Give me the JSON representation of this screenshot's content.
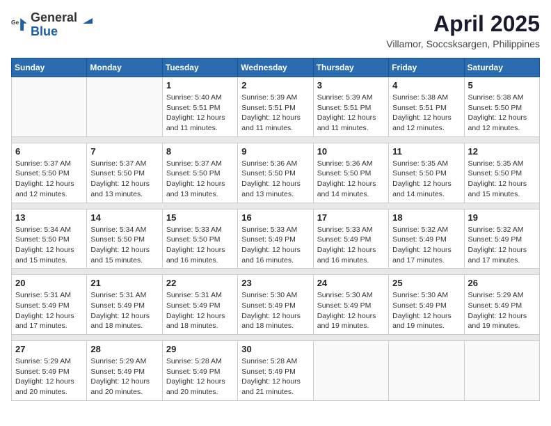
{
  "logo": {
    "general": "General",
    "blue": "Blue"
  },
  "title": "April 2025",
  "subtitle": "Villamor, Soccsksargen, Philippines",
  "weekdays": [
    "Sunday",
    "Monday",
    "Tuesday",
    "Wednesday",
    "Thursday",
    "Friday",
    "Saturday"
  ],
  "weeks": [
    [
      {
        "day": "",
        "sunrise": "",
        "sunset": "",
        "daylight": ""
      },
      {
        "day": "",
        "sunrise": "",
        "sunset": "",
        "daylight": ""
      },
      {
        "day": "1",
        "sunrise": "Sunrise: 5:40 AM",
        "sunset": "Sunset: 5:51 PM",
        "daylight": "Daylight: 12 hours and 11 minutes."
      },
      {
        "day": "2",
        "sunrise": "Sunrise: 5:39 AM",
        "sunset": "Sunset: 5:51 PM",
        "daylight": "Daylight: 12 hours and 11 minutes."
      },
      {
        "day": "3",
        "sunrise": "Sunrise: 5:39 AM",
        "sunset": "Sunset: 5:51 PM",
        "daylight": "Daylight: 12 hours and 11 minutes."
      },
      {
        "day": "4",
        "sunrise": "Sunrise: 5:38 AM",
        "sunset": "Sunset: 5:51 PM",
        "daylight": "Daylight: 12 hours and 12 minutes."
      },
      {
        "day": "5",
        "sunrise": "Sunrise: 5:38 AM",
        "sunset": "Sunset: 5:50 PM",
        "daylight": "Daylight: 12 hours and 12 minutes."
      }
    ],
    [
      {
        "day": "6",
        "sunrise": "Sunrise: 5:37 AM",
        "sunset": "Sunset: 5:50 PM",
        "daylight": "Daylight: 12 hours and 12 minutes."
      },
      {
        "day": "7",
        "sunrise": "Sunrise: 5:37 AM",
        "sunset": "Sunset: 5:50 PM",
        "daylight": "Daylight: 12 hours and 13 minutes."
      },
      {
        "day": "8",
        "sunrise": "Sunrise: 5:37 AM",
        "sunset": "Sunset: 5:50 PM",
        "daylight": "Daylight: 12 hours and 13 minutes."
      },
      {
        "day": "9",
        "sunrise": "Sunrise: 5:36 AM",
        "sunset": "Sunset: 5:50 PM",
        "daylight": "Daylight: 12 hours and 13 minutes."
      },
      {
        "day": "10",
        "sunrise": "Sunrise: 5:36 AM",
        "sunset": "Sunset: 5:50 PM",
        "daylight": "Daylight: 12 hours and 14 minutes."
      },
      {
        "day": "11",
        "sunrise": "Sunrise: 5:35 AM",
        "sunset": "Sunset: 5:50 PM",
        "daylight": "Daylight: 12 hours and 14 minutes."
      },
      {
        "day": "12",
        "sunrise": "Sunrise: 5:35 AM",
        "sunset": "Sunset: 5:50 PM",
        "daylight": "Daylight: 12 hours and 15 minutes."
      }
    ],
    [
      {
        "day": "13",
        "sunrise": "Sunrise: 5:34 AM",
        "sunset": "Sunset: 5:50 PM",
        "daylight": "Daylight: 12 hours and 15 minutes."
      },
      {
        "day": "14",
        "sunrise": "Sunrise: 5:34 AM",
        "sunset": "Sunset: 5:50 PM",
        "daylight": "Daylight: 12 hours and 15 minutes."
      },
      {
        "day": "15",
        "sunrise": "Sunrise: 5:33 AM",
        "sunset": "Sunset: 5:50 PM",
        "daylight": "Daylight: 12 hours and 16 minutes."
      },
      {
        "day": "16",
        "sunrise": "Sunrise: 5:33 AM",
        "sunset": "Sunset: 5:49 PM",
        "daylight": "Daylight: 12 hours and 16 minutes."
      },
      {
        "day": "17",
        "sunrise": "Sunrise: 5:33 AM",
        "sunset": "Sunset: 5:49 PM",
        "daylight": "Daylight: 12 hours and 16 minutes."
      },
      {
        "day": "18",
        "sunrise": "Sunrise: 5:32 AM",
        "sunset": "Sunset: 5:49 PM",
        "daylight": "Daylight: 12 hours and 17 minutes."
      },
      {
        "day": "19",
        "sunrise": "Sunrise: 5:32 AM",
        "sunset": "Sunset: 5:49 PM",
        "daylight": "Daylight: 12 hours and 17 minutes."
      }
    ],
    [
      {
        "day": "20",
        "sunrise": "Sunrise: 5:31 AM",
        "sunset": "Sunset: 5:49 PM",
        "daylight": "Daylight: 12 hours and 17 minutes."
      },
      {
        "day": "21",
        "sunrise": "Sunrise: 5:31 AM",
        "sunset": "Sunset: 5:49 PM",
        "daylight": "Daylight: 12 hours and 18 minutes."
      },
      {
        "day": "22",
        "sunrise": "Sunrise: 5:31 AM",
        "sunset": "Sunset: 5:49 PM",
        "daylight": "Daylight: 12 hours and 18 minutes."
      },
      {
        "day": "23",
        "sunrise": "Sunrise: 5:30 AM",
        "sunset": "Sunset: 5:49 PM",
        "daylight": "Daylight: 12 hours and 18 minutes."
      },
      {
        "day": "24",
        "sunrise": "Sunrise: 5:30 AM",
        "sunset": "Sunset: 5:49 PM",
        "daylight": "Daylight: 12 hours and 19 minutes."
      },
      {
        "day": "25",
        "sunrise": "Sunrise: 5:30 AM",
        "sunset": "Sunset: 5:49 PM",
        "daylight": "Daylight: 12 hours and 19 minutes."
      },
      {
        "day": "26",
        "sunrise": "Sunrise: 5:29 AM",
        "sunset": "Sunset: 5:49 PM",
        "daylight": "Daylight: 12 hours and 19 minutes."
      }
    ],
    [
      {
        "day": "27",
        "sunrise": "Sunrise: 5:29 AM",
        "sunset": "Sunset: 5:49 PM",
        "daylight": "Daylight: 12 hours and 20 minutes."
      },
      {
        "day": "28",
        "sunrise": "Sunrise: 5:29 AM",
        "sunset": "Sunset: 5:49 PM",
        "daylight": "Daylight: 12 hours and 20 minutes."
      },
      {
        "day": "29",
        "sunrise": "Sunrise: 5:28 AM",
        "sunset": "Sunset: 5:49 PM",
        "daylight": "Daylight: 12 hours and 20 minutes."
      },
      {
        "day": "30",
        "sunrise": "Sunrise: 5:28 AM",
        "sunset": "Sunset: 5:49 PM",
        "daylight": "Daylight: 12 hours and 21 minutes."
      },
      {
        "day": "",
        "sunrise": "",
        "sunset": "",
        "daylight": ""
      },
      {
        "day": "",
        "sunrise": "",
        "sunset": "",
        "daylight": ""
      },
      {
        "day": "",
        "sunrise": "",
        "sunset": "",
        "daylight": ""
      }
    ]
  ]
}
